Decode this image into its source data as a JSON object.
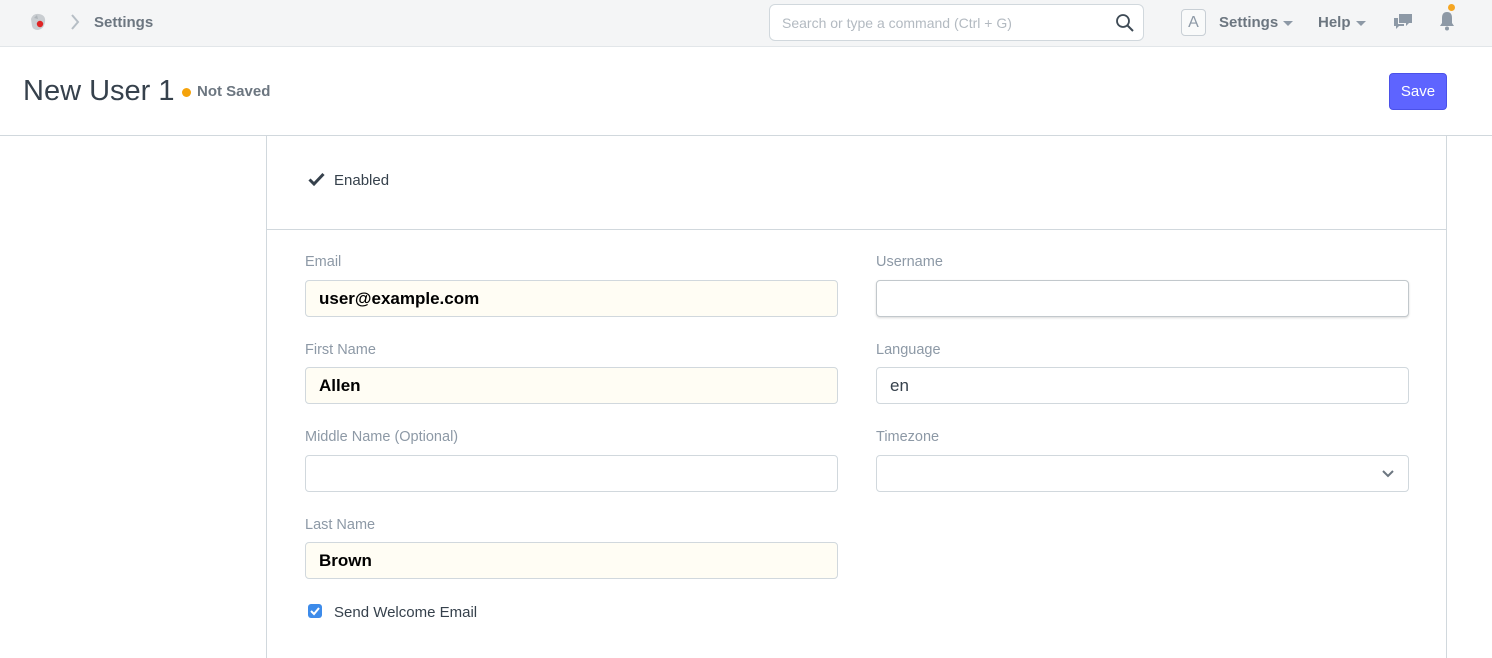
{
  "navbar": {
    "breadcrumb": "Settings",
    "search_placeholder": "Search or type a command (Ctrl + G)",
    "avatar_letter": "A",
    "settings_menu": "Settings",
    "help_menu": "Help",
    "icons": [
      "app-logo-icon",
      "chevron-right-icon",
      "search-icon",
      "chat-icon",
      "bell-icon"
    ],
    "notification_color": "#f5a623"
  },
  "page": {
    "title": "New User 1",
    "status": "Not Saved",
    "status_color": "#f5a30b",
    "save_label": "Save",
    "accent_color": "#5e64ff"
  },
  "form": {
    "enabled": {
      "label": "Enabled",
      "checked": true
    },
    "email": {
      "label": "Email",
      "value": "user@example.com"
    },
    "first_name": {
      "label": "First Name",
      "value": "Allen"
    },
    "middle_name": {
      "label": "Middle Name (Optional)",
      "value": ""
    },
    "last_name": {
      "label": "Last Name",
      "value": "Brown"
    },
    "username": {
      "label": "Username",
      "value": ""
    },
    "language": {
      "label": "Language",
      "value": "en"
    },
    "timezone": {
      "label": "Timezone",
      "value": ""
    },
    "send_welcome_email": {
      "label": "Send Welcome Email",
      "checked": true
    }
  }
}
